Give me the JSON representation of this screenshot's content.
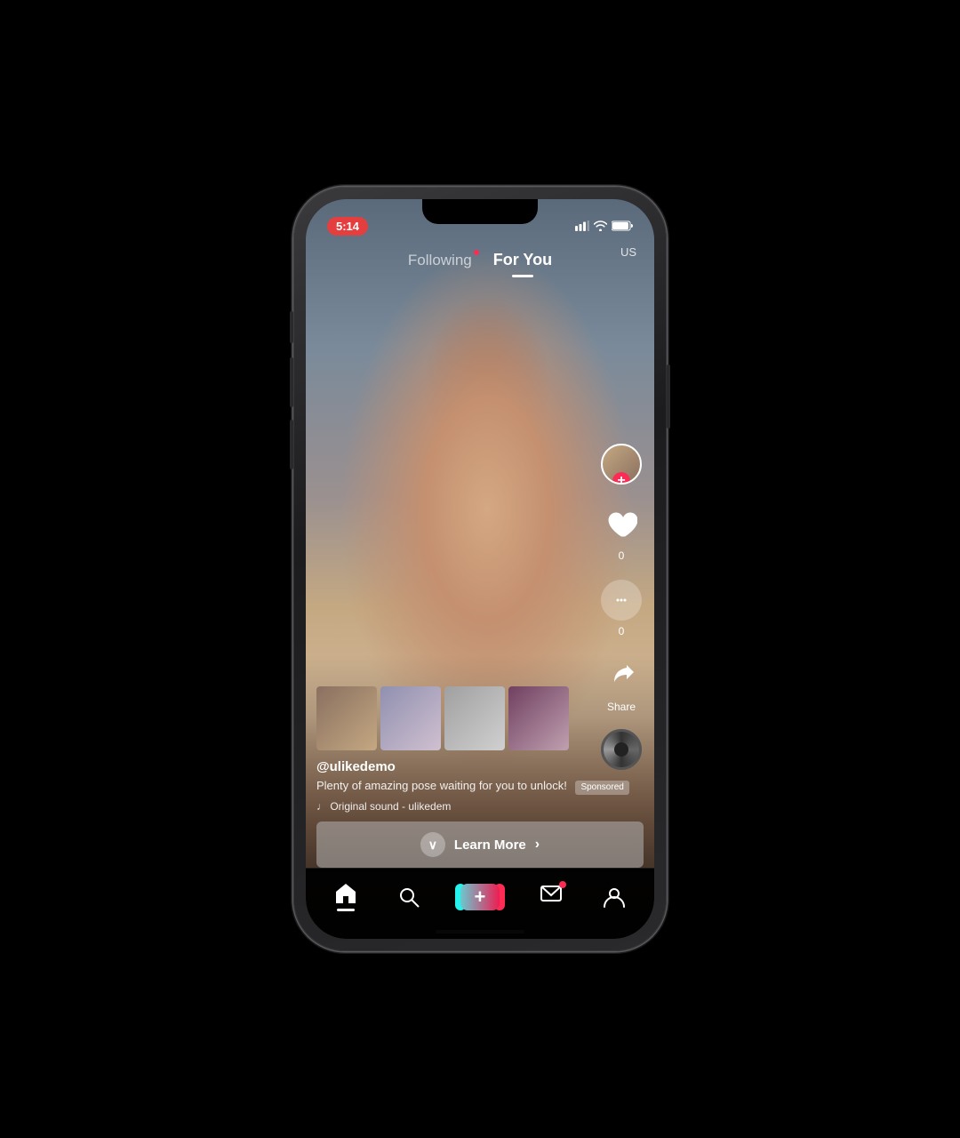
{
  "status": {
    "time": "5:14",
    "region": "US"
  },
  "nav": {
    "following_label": "Following",
    "for_you_label": "For You",
    "active_tab": "for_you"
  },
  "video": {
    "username": "@ulikedemo",
    "caption": "Plenty of amazing pose waiting for you to unlock!",
    "sponsored_label": "Sponsored",
    "sound": "♩  Original sound - ulikedem",
    "like_count": "0",
    "comment_count": "0",
    "share_label": "Share"
  },
  "cta": {
    "learn_more_label": "Learn More",
    "arrow": "›"
  },
  "bottom_nav": {
    "home": "🏠",
    "search": "🔍",
    "add": "+",
    "messages": "💬",
    "profile": "👤"
  }
}
